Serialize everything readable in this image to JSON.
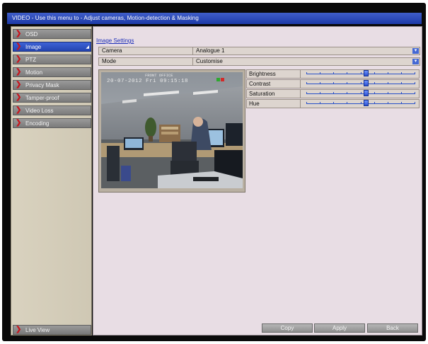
{
  "window": {
    "title": "VIDEO - Use this menu to - Adjust cameras, Motion-detection & Masking"
  },
  "sidebar": {
    "items": [
      {
        "label": "OSD"
      },
      {
        "label": "Image",
        "active": true
      },
      {
        "label": "PTZ"
      },
      {
        "label": "Motion"
      },
      {
        "label": "Privacy Mask"
      },
      {
        "label": "Tamper-proof"
      },
      {
        "label": "Video Loss"
      },
      {
        "label": "Encoding"
      }
    ],
    "live_view": "Live View"
  },
  "main": {
    "section_title": "Image Settings",
    "fields": [
      {
        "label": "Camera",
        "value": "Analogue 1"
      },
      {
        "label": "Mode",
        "value": "Customise"
      }
    ],
    "preview": {
      "osd_date": "20-07-2012 Fri 09:15:18",
      "osd_camera_name": "FRONT OFFICE"
    },
    "sliders": [
      {
        "label": "Brightness",
        "value": 0.55
      },
      {
        "label": "Contrast",
        "value": 0.55
      },
      {
        "label": "Saturation",
        "value": 0.55
      },
      {
        "label": "Hue",
        "value": 0.55
      }
    ]
  },
  "buttons": {
    "copy": "Copy",
    "apply": "Apply",
    "back": "Back"
  },
  "colors": {
    "title_bar": "#2d4cba",
    "accent": "#2344b0",
    "chevron": "#c8161d",
    "panel_bg": "#e8dde4"
  }
}
